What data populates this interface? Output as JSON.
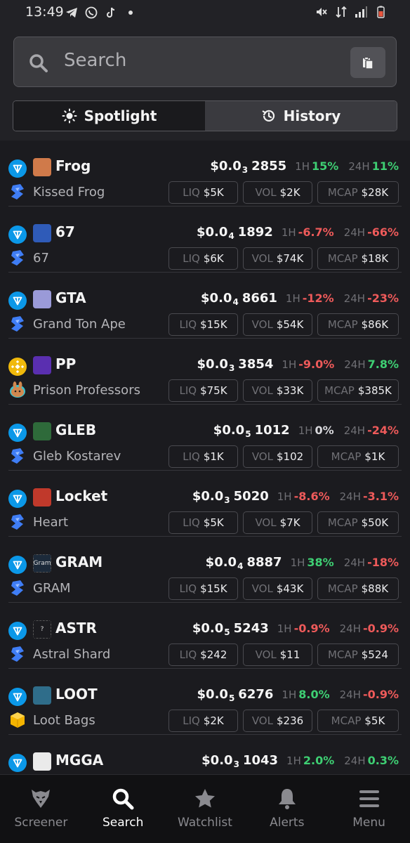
{
  "status_bar": {
    "time": "13:49",
    "left_icons": [
      "telegram-icon",
      "whatsapp-icon",
      "tiktok-icon",
      "dot-icon"
    ],
    "right_icons": [
      "mute-icon",
      "data-icon",
      "signal-icon",
      "battery-icon"
    ]
  },
  "search": {
    "placeholder": "Search"
  },
  "tabs": [
    {
      "label": "Spotlight",
      "icon": "sun-icon",
      "active": true
    },
    {
      "label": "History",
      "icon": "history-icon",
      "active": false
    }
  ],
  "labels": {
    "h1": "1H",
    "h24": "24H",
    "liq": "LIQ",
    "vol": "VOL",
    "mcap": "MCAP"
  },
  "tokens": [
    {
      "symbol": "Frog",
      "name": "Kissed Frog",
      "chain": "ton",
      "dex": "stonfi",
      "price_prefix": "$0.0",
      "price_zeros": "3",
      "price_digits": "2855",
      "change_1h": "15%",
      "change_1h_dir": "pos",
      "change_24h": "11%",
      "change_24h_dir": "pos",
      "liq": "$5K",
      "vol": "$2K",
      "mcap": "$28K",
      "img_color": "#d07a4a"
    },
    {
      "symbol": "67",
      "name": "67",
      "chain": "ton",
      "dex": "stonfi",
      "price_prefix": "$0.0",
      "price_zeros": "4",
      "price_digits": "1892",
      "change_1h": "-6.7%",
      "change_1h_dir": "neg",
      "change_24h": "-66%",
      "change_24h_dir": "neg",
      "liq": "$6K",
      "vol": "$74K",
      "mcap": "$18K",
      "img_color": "#2f5bb8"
    },
    {
      "symbol": "GTA",
      "name": "Grand Ton Ape",
      "chain": "ton",
      "dex": "stonfi",
      "price_prefix": "$0.0",
      "price_zeros": "4",
      "price_digits": "8661",
      "change_1h": "-12%",
      "change_1h_dir": "neg",
      "change_24h": "-23%",
      "change_24h_dir": "neg",
      "liq": "$15K",
      "vol": "$54K",
      "mcap": "$86K",
      "img_color": "#9a9ad8"
    },
    {
      "symbol": "PP",
      "name": "Prison Professors",
      "chain": "bnb",
      "dex": "pancake",
      "price_prefix": "$0.0",
      "price_zeros": "3",
      "price_digits": "3854",
      "change_1h": "-9.0%",
      "change_1h_dir": "neg",
      "change_24h": "7.8%",
      "change_24h_dir": "pos",
      "liq": "$75K",
      "vol": "$33K",
      "mcap": "$385K",
      "img_color": "#5a2fb0"
    },
    {
      "symbol": "GLEB",
      "name": "Gleb Kostarev",
      "chain": "ton",
      "dex": "stonfi",
      "price_prefix": "$0.0",
      "price_zeros": "5",
      "price_digits": "1012",
      "change_1h": "0%",
      "change_1h_dir": "neu",
      "change_24h": "-24%",
      "change_24h_dir": "neg",
      "liq": "$1K",
      "vol": "$102",
      "mcap": "$1K",
      "img_color": "#2e6a3a"
    },
    {
      "symbol": "Locket",
      "name": "Heart",
      "chain": "ton",
      "dex": "stonfi",
      "price_prefix": "$0.0",
      "price_zeros": "3",
      "price_digits": "5020",
      "change_1h": "-8.6%",
      "change_1h_dir": "neg",
      "change_24h": "-3.1%",
      "change_24h_dir": "neg",
      "liq": "$5K",
      "vol": "$7K",
      "mcap": "$50K",
      "img_color": "#c0392b"
    },
    {
      "symbol": "GRAM",
      "name": "GRAM",
      "chain": "ton",
      "dex": "stonfi",
      "price_prefix": "$0.0",
      "price_zeros": "4",
      "price_digits": "8887",
      "change_1h": "38%",
      "change_1h_dir": "pos",
      "change_24h": "-18%",
      "change_24h_dir": "neg",
      "liq": "$15K",
      "vol": "$43K",
      "mcap": "$88K",
      "img_color": "#1c2a3a",
      "img_text": "Gram"
    },
    {
      "symbol": "ASTR",
      "name": "Astral Shard",
      "chain": "ton",
      "dex": "stonfi",
      "price_prefix": "$0.0",
      "price_zeros": "5",
      "price_digits": "5243",
      "change_1h": "-0.9%",
      "change_1h_dir": "neg",
      "change_24h": "-0.9%",
      "change_24h_dir": "neg",
      "liq": "$242",
      "vol": "$11",
      "mcap": "$524",
      "img_color": "#1b1b1f",
      "img_text": "?"
    },
    {
      "symbol": "LOOT",
      "name": "Loot Bags",
      "chain": "ton",
      "dex": "dedust",
      "price_prefix": "$0.0",
      "price_zeros": "5",
      "price_digits": "6276",
      "change_1h": "8.0%",
      "change_1h_dir": "pos",
      "change_24h": "-0.9%",
      "change_24h_dir": "neg",
      "liq": "$2K",
      "vol": "$236",
      "mcap": "$5K",
      "img_color": "#2f6d8a"
    },
    {
      "symbol": "MGGA",
      "name": "",
      "chain": "ton",
      "dex": "stonfi",
      "price_prefix": "$0.0",
      "price_zeros": "3",
      "price_digits": "1043",
      "change_1h": "2.0%",
      "change_1h_dir": "pos",
      "change_24h": "0.3%",
      "change_24h_dir": "pos",
      "liq": "",
      "vol": "",
      "mcap": "",
      "img_color": "#eaeaea"
    }
  ],
  "nav": [
    {
      "label": "Screener",
      "icon": "eagle-icon",
      "active": false
    },
    {
      "label": "Search",
      "icon": "search-icon",
      "active": true
    },
    {
      "label": "Watchlist",
      "icon": "star-icon",
      "active": false
    },
    {
      "label": "Alerts",
      "icon": "bell-icon",
      "active": false
    },
    {
      "label": "Menu",
      "icon": "menu-icon",
      "active": false
    }
  ]
}
